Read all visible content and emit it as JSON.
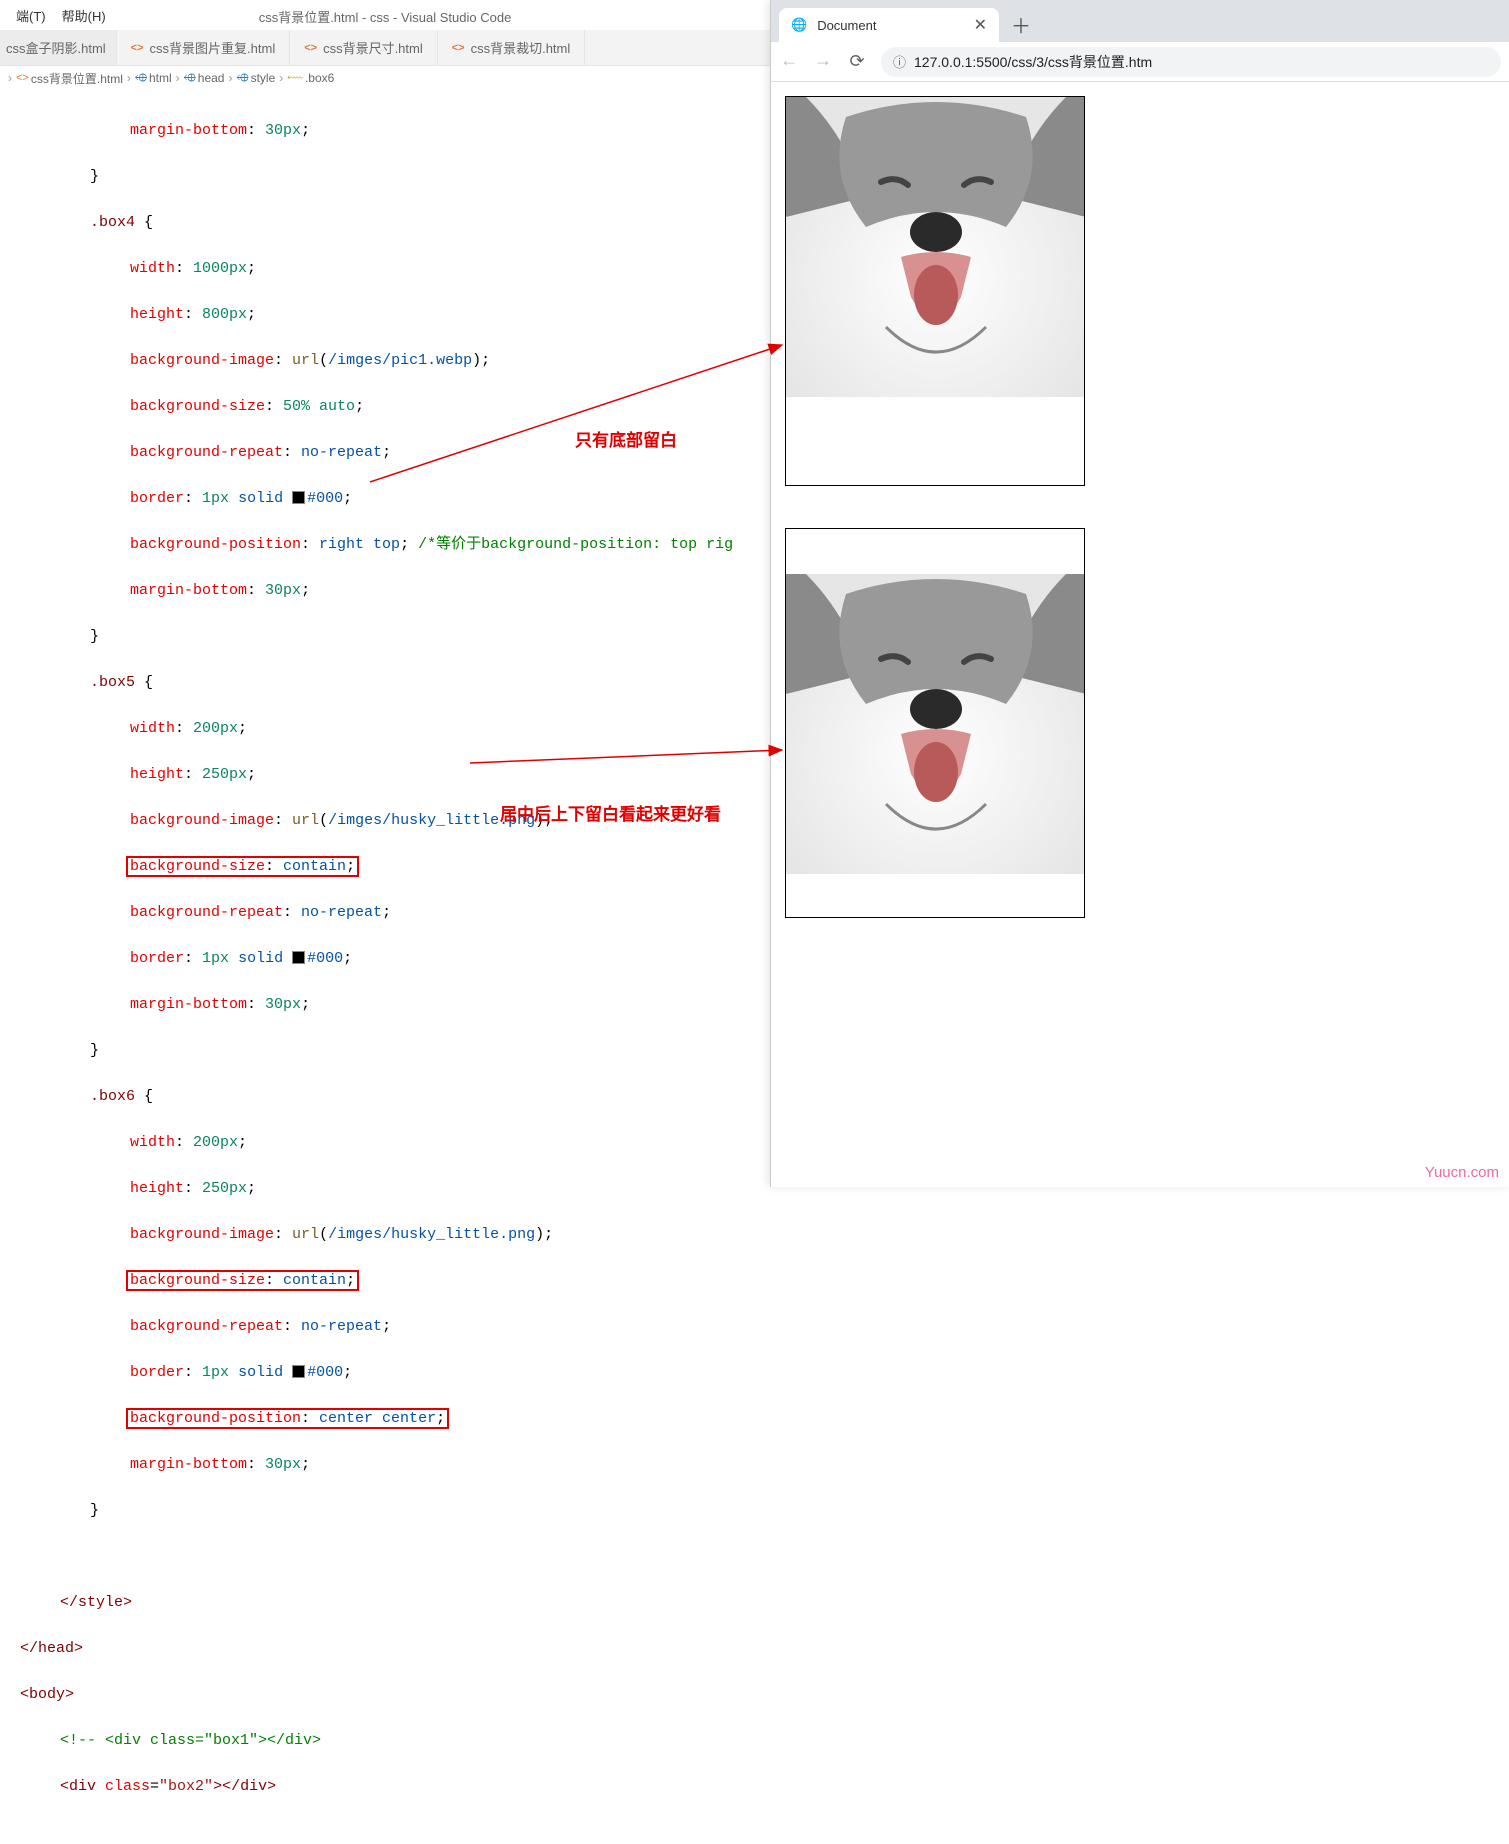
{
  "menu": {
    "item1": "端(T)",
    "item2": "帮助(H)"
  },
  "window_title": "css背景位置.html - css - Visual Studio Code",
  "tabs": {
    "t0": "css盒子阴影.html",
    "t1": "css背景图片重复.html",
    "t2": "css背景尺寸.html",
    "t3": "css背景裁切.html"
  },
  "breadcrumb": {
    "b0": "<> css背景位置.html",
    "b1": "html",
    "b2": "head",
    "b3": "style",
    "b4": ".box6"
  },
  "code": {
    "l1a": "margin-bottom",
    "l1b": "30px",
    "box4": ".box4",
    "b4_w": "width",
    "b4_wv": "1000px",
    "b4_h": "height",
    "b4_hv": "800px",
    "b4_bi": "background-image",
    "b4_biv": "/imges/pic1.webp",
    "b4_bs": "background-size",
    "b4_bsv": "50% auto",
    "b4_br": "background-repeat",
    "b4_brv": "no-repeat",
    "b4_bd": "border",
    "b4_bdv1": "1px",
    "b4_bdv2": "solid",
    "b4_bdv3": "#000",
    "b4_bp": "background-position",
    "b4_bpv": "right top",
    "b4_cmt": "/*等价于background-position: top rig",
    "b4_mb": "margin-bottom",
    "b4_mbv": "30px",
    "box5": ".box5",
    "b5_w": "width",
    "b5_wv": "200px",
    "b5_h": "height",
    "b5_hv": "250px",
    "b5_bi": "background-image",
    "b5_biv": "/imges/husky_little.png",
    "b5_bs": "background-size",
    "b5_bsv": "contain",
    "b5_br": "background-repeat",
    "b5_brv": "no-repeat",
    "b5_bd": "border",
    "b5_bdv1": "1px",
    "b5_bdv2": "solid",
    "b5_bdv3": "#000",
    "b5_mb": "margin-bottom",
    "b5_mbv": "30px",
    "box6": ".box6",
    "b6_w": "width",
    "b6_wv": "200px",
    "b6_h": "height",
    "b6_hv": "250px",
    "b6_bi": "background-image",
    "b6_biv": "/imges/husky_little.png",
    "b6_bs": "background-size",
    "b6_bsv": "contain",
    "b6_br": "background-repeat",
    "b6_brv": "no-repeat",
    "b6_bd": "border",
    "b6_bdv1": "1px",
    "b6_bdv2": "solid",
    "b6_bdv3": "#000",
    "b6_bp": "background-position",
    "b6_bpv": "center center",
    "b6_mb": "margin-bottom",
    "b6_mbv": "30px",
    "end_style": "</style>",
    "end_head": "</head>",
    "body_tag": "<body>",
    "cmt_box1": "<!-- <div class=\"box1\"></div>",
    "div_box2_open": "<div",
    "div_box2_cls": " class=",
    "div_box2_val": "\"box2\"",
    "div_box2_close": "></div>"
  },
  "annotations": {
    "a1": "只有底部留白",
    "a2": "居中后上下留白看起来更好看"
  },
  "browser": {
    "tab_title": "Document",
    "url": "127.0.0.1:5500/css/3/css背景位置.htm"
  },
  "watermark": "Yuucn.com"
}
